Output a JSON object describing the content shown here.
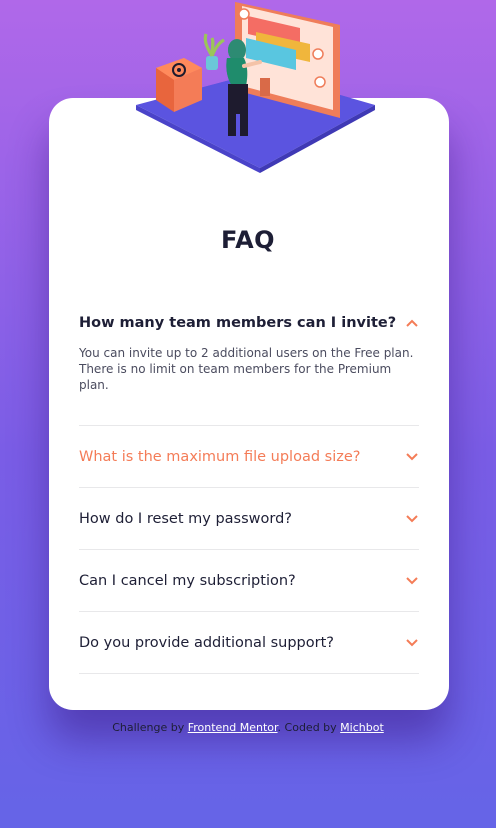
{
  "faq": {
    "title": "FAQ",
    "items": [
      {
        "question": "How many team members can I invite?",
        "answer": "You can invite up to 2 additional users on the Free plan. There is no limit on team members for the Premium plan.",
        "state": "open"
      },
      {
        "question": "What is the maximum file upload size?",
        "state": "collapsed-hover"
      },
      {
        "question": "How do I reset my password?",
        "state": "collapsed"
      },
      {
        "question": "Can I cancel my subscription?",
        "state": "collapsed"
      },
      {
        "question": "Do you provide additional support?",
        "state": "collapsed"
      }
    ]
  },
  "attribution": {
    "prefix": "Challenge by",
    "link1": "Frontend Mentor",
    "middle": ". Coded by",
    "link2": "Michbot"
  },
  "colors": {
    "accent": "#f47c57",
    "heading": "#1d1e35",
    "background_top": "#b068e9",
    "background_bottom": "#6564e7"
  },
  "icons": {
    "illustration": "woman-online-illustration",
    "box": "box-illustration",
    "chevron": "chevron-icon"
  }
}
